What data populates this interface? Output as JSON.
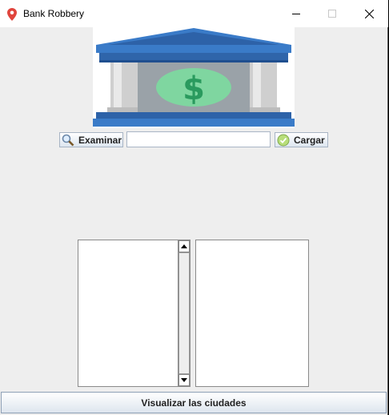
{
  "window": {
    "title": "Bank Robbery",
    "icons": {
      "app": "map-pin-icon",
      "minimize": "minimize-icon",
      "maximize": "maximize-icon",
      "close": "close-icon"
    }
  },
  "logo": {
    "icon": "bank-dollar-icon",
    "colors": {
      "roof": "#3a7bc8",
      "base": "#2d62a8",
      "dollar": "#2a9a5e",
      "coin": "#7fd6a0"
    }
  },
  "toolbar": {
    "browse_label": "Examinar",
    "browse_icon": "magnifier-icon",
    "path_value": "",
    "load_label": "Cargar",
    "load_icon": "check-icon"
  },
  "lists": {
    "left_items": [],
    "right_items": []
  },
  "footer": {
    "visualize_label": "Visualizar las ciudades"
  }
}
